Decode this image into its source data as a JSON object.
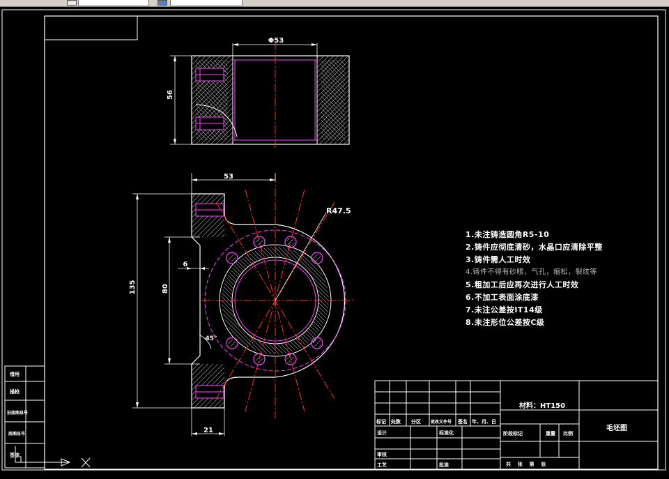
{
  "toolbar": {
    "items": [
      "layer-field",
      "style-field",
      "props-field"
    ]
  },
  "drawing": {
    "dimensions": {
      "bore_dia": "Φ53",
      "height": "56",
      "width_top": "53",
      "radius": "R47.5",
      "height_total": "135",
      "height_inner": "80",
      "slot": "6",
      "angle": "45°",
      "flange": "21"
    }
  },
  "notes": [
    "1.未注铸造圆角R5-10",
    "2.铸件应彻底清砂，水晶口应清除平整",
    "3.铸件需人工时效",
    "4.铸件不得有砂眼，气孔，缩松，裂纹等",
    "5.粗加工后应再次进行人工时效",
    "6.不加工表面涂底漆",
    "7.未注公差按IT14级",
    "8.未注形位公差按C级"
  ],
  "title_block": {
    "material": "材料：HT150",
    "drawing_name": "毛坯图",
    "row_headers": [
      "标记",
      "处数",
      "分区",
      "更改文件号",
      "签名",
      "年、月、日"
    ],
    "design": "设计",
    "standard": "标准化",
    "review": "审核",
    "process": "工艺",
    "approve": "批准",
    "stage": "阶段标记",
    "weight": "重量",
    "scale": "比例",
    "sheet": "共    张    第    张"
  },
  "side_block": {
    "items": [
      "借用",
      "描校",
      "旧底图总号",
      "底图总号"
    ],
    "sign": "签字"
  }
}
